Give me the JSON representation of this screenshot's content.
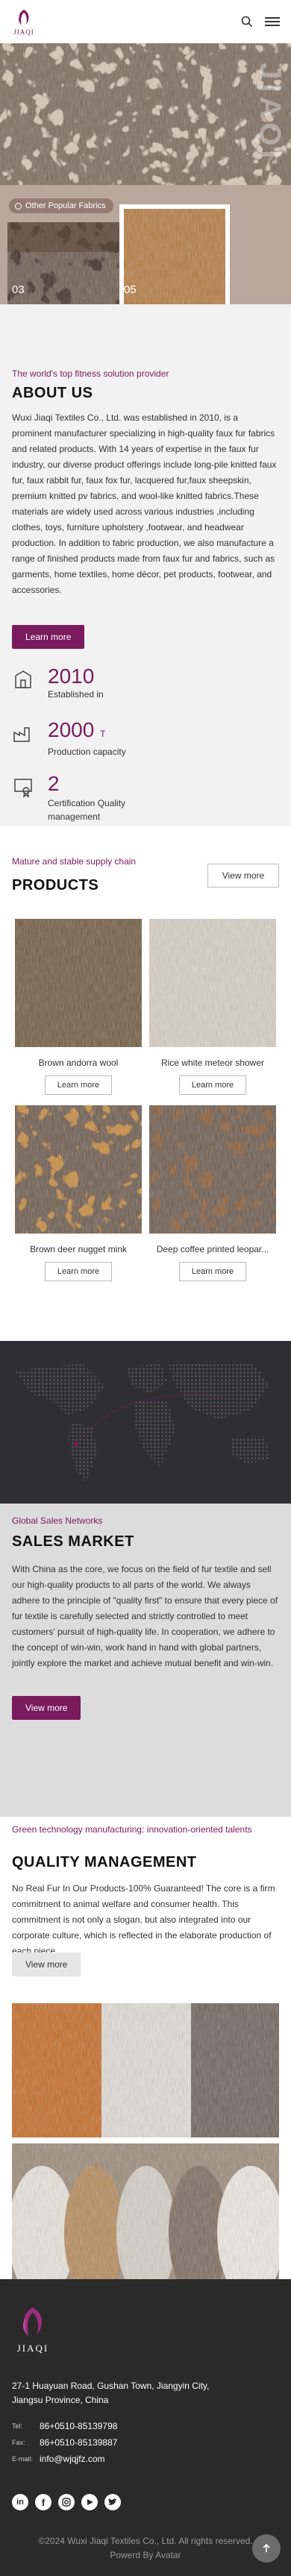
{
  "header": {
    "logo_text": "JIAQI",
    "search_icon": "search-icon",
    "menu_icon": "hamburger-menu-icon"
  },
  "hero": {
    "watermark": "JIAQI",
    "tag": "Other Popular Fabrics",
    "slide_a": "03",
    "slide_b": "05"
  },
  "about": {
    "eyebrow": "The world's top fitness solution provider",
    "title": "ABOUT US",
    "body": "Wuxi Jiaqi Textiles Co., Ltd. was established in 2010, is a prominent manufacturer specializing in high-quality faux fur fabrics and related products. With 14 years of expertise in the faux fur industry, our diverse product offerings include long-pile knitted faux fur, faux rabbit fur, faux fox fur, lacquered fur,faux sheepskin, premium knitted pv fabrics, and wool-like knitted fabrics.These materials are widely used across various industries ,including clothes, toys, furniture upholstery ,footwear, and headwear production. In addition to fabric production, we also manufacture a range of finished products made from faux fur and fabrics, such as garments, home textiles, home décor, pet products, footwear, and accessories.",
    "button": "Learn more",
    "stats": [
      {
        "value": "2010",
        "unit": "",
        "label": "Established in"
      },
      {
        "value": "2000",
        "unit": "T",
        "label": "Production capacity"
      },
      {
        "value": "2",
        "unit": "",
        "label": "Certification Quality management"
      }
    ]
  },
  "products": {
    "eyebrow": "Mature and stable supply chain",
    "title": "PRODUCTS",
    "view_more": "View more",
    "items": [
      {
        "name": "Brown andorra wool",
        "button": "Learn more"
      },
      {
        "name": "Rice white meteor shower",
        "button": "Learn more"
      },
      {
        "name": "Brown deer nugget mink",
        "button": "Learn more"
      },
      {
        "name": "Deep coffee printed leopar...",
        "button": "Learn more"
      }
    ]
  },
  "sales": {
    "eyebrow": "Global Sales Networks",
    "title": "SALES MARKET",
    "body": "With China as the core, we focus on the field of fur textile and sell our high-quality products to all parts of the world. We always adhere to the principle of \"quality first\" to ensure that every piece of fur textile is carefully selected and strictly controlled to meet customers' pursuit of high-quality life. In cooperation, we adhere to the concept of win-win, work hand in hand with global partners, jointly explore the market and achieve mutual benefit and win-win.",
    "button": "View more"
  },
  "quality": {
    "eyebrow": "Green technology manufacturing: innovation-oriented talents",
    "title": "QUALITY MANAGEMENT",
    "body": "No Real Fur In Our Products-100% Guaranteed! The core is a firm commitment to animal welfare and consumer health. This commitment is not only a slogan, but also integrated into our corporate culture, which is reflected in the elaborate production of each piece.",
    "button": "View more"
  },
  "footer": {
    "logo_text": "JIAQI",
    "address": "27-1 Huayuan Road, Gushan Town, Jiangyin City, Jiangsu Province, China",
    "tel_label": "Tel:",
    "tel": "86+0510-85139798",
    "fax_label": "Fax:",
    "fax": "86+0510-85139887",
    "email_label": "E-mail:",
    "email": "info@wjqjfz.com",
    "social": [
      "linkedin-icon",
      "facebook-icon",
      "instagram-icon",
      "youtube-icon",
      "twitter-icon"
    ],
    "copyright": "©2024 Wuxi Jiaqi Textiles Co., Ltd. All rights reserved.",
    "powered": "Powerd By Avatar"
  },
  "colors": {
    "accent": "#7a1b5e",
    "footer_bg": "#2a2a2a",
    "about_bg": "#f2f2f2",
    "sales_bg": "#dcdcdc"
  }
}
